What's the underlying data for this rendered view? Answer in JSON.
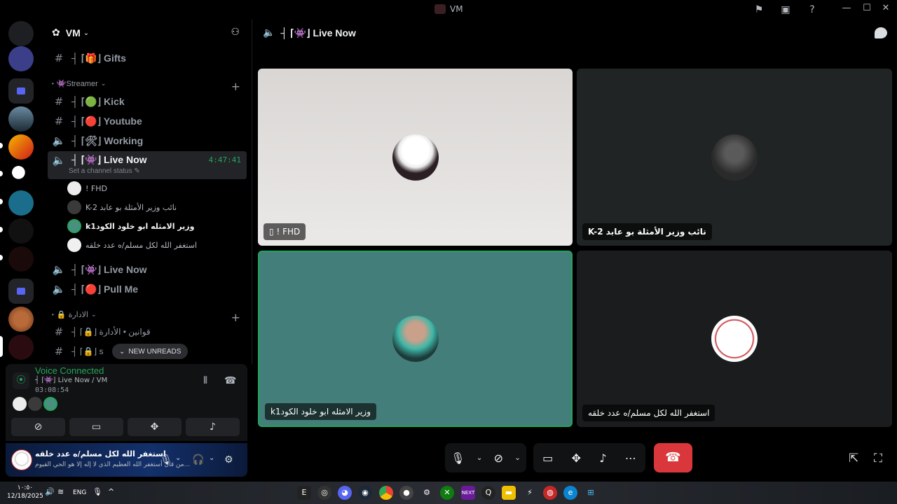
{
  "window": {
    "title": "VM"
  },
  "guild": {
    "name": "VM"
  },
  "channels": {
    "gifts": "┤ ⌈🎁⌋ Gifts",
    "streamer_category": "👾Streamer",
    "kick": "┤ ⌈🟢⌋ Kick",
    "youtube": "┤ ⌈🔴⌋ Youtube",
    "working": "┤ ⌈🛠⌋ Working",
    "live_now": "┤ ⌈👾⌋ Live Now",
    "live_now_time": "4:47:41",
    "live_now_status": "Set a channel status",
    "live_now_2": "┤ ⌈👾⌋ Live Now",
    "pull_me": "┤ ⌈🔴⌋ Pull Me",
    "admin_category": "🔒 الادارة",
    "admin_rules": "┤ ⌈🔒⌋ قوانين • الأدارة",
    "admin_second": "┤ ⌈🔒⌋ s"
  },
  "voice_users": [
    {
      "name": "! FHD",
      "color": "#e8e8e8"
    },
    {
      "name": "K-2 نائب وزير الأمثلة بو عابد",
      "color": "#3a3a3a"
    },
    {
      "name": "k1وزير الامثله ابو خلود الكود",
      "color": "#4a9080"
    },
    {
      "name": "استغفر الله لكل مسلم/ه عدد خلقه",
      "color": "#f0f0f0"
    }
  ],
  "new_unreads": "NEW UNREADS",
  "voice_panel": {
    "title": "Voice Connected",
    "channel": "┤ ⌈👾⌋ Live Now / VM",
    "elapsed": "03:08:54"
  },
  "user_panel": {
    "name": "استغفر الله لكل مسلم/ه عدد خلقه",
    "status": "من قال أستغفر الله العظيم الذي لا إله إلا هو الحي القيوم..."
  },
  "main": {
    "title": "┤ ⌈👾⌋ Live Now",
    "tiles": [
      {
        "name": "! FHD",
        "bg": "#e6e3e1"
      },
      {
        "name": "K-2 نائب وزير الأمثلة بو عابد",
        "bg": "#202424"
      },
      {
        "name": "k1وزير الامثله ابو خلود الكود",
        "bg": "#447e7a"
      },
      {
        "name": "استغفر الله لكل مسلم/ه عدد خلقه",
        "bg": "#1b1c1d"
      }
    ]
  },
  "taskbar": {
    "time": "١٠:٥٠",
    "date": "12/18/2025",
    "lang": "ENG"
  },
  "colors": {
    "accent_green": "#23a55a",
    "hangup_red": "#da373c",
    "background": "#000000"
  }
}
